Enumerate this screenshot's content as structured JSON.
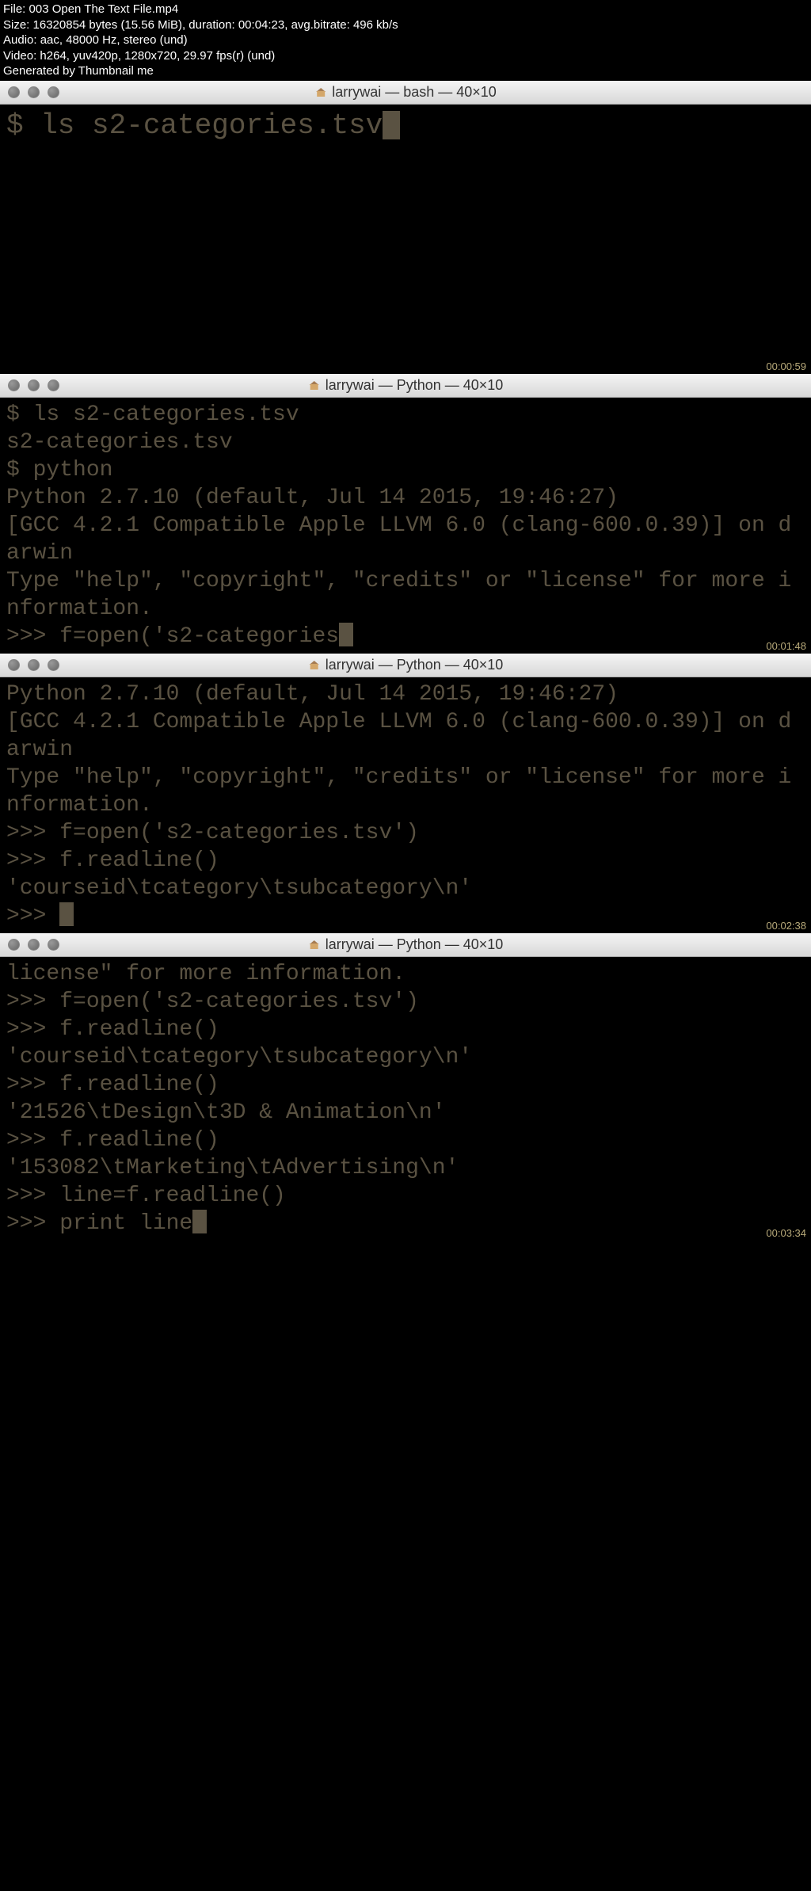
{
  "header": {
    "file": "File: 003 Open The Text File.mp4",
    "size": "Size: 16320854 bytes (15.56 MiB), duration: 00:04:23, avg.bitrate: 496 kb/s",
    "audio": "Audio: aac, 48000 Hz, stereo (und)",
    "video": "Video: h264, yuv420p, 1280x720, 29.97 fps(r) (und)",
    "generated": "Generated by Thumbnail me"
  },
  "windows": [
    {
      "title": "larrywai — bash — 40×10",
      "timestamp": "00:00:59",
      "content": "$ ls s2-categories.tsv",
      "cursor": true,
      "large": true
    },
    {
      "title": "larrywai — Python — 40×10",
      "timestamp": "00:01:48",
      "content": "$ ls s2-categories.tsv\ns2-categories.tsv\n$ python\nPython 2.7.10 (default, Jul 14 2015, 19:46:27)\n[GCC 4.2.1 Compatible Apple LLVM 6.0 (clang-600.0.39)] on darwin\nType \"help\", \"copyright\", \"credits\" or \"license\" for more information.\n>>> f=open('s2-categories",
      "cursor": true,
      "large": false
    },
    {
      "title": "larrywai — Python — 40×10",
      "timestamp": "00:02:38",
      "content_pre": "Python 2.7.10 (default, Jul 14 2015, 19:46:27)\n[GCC 4.2.1 Compatible Apple LLVM 6.0 (clang-600.0.39)] on darwin\nType \"help\", \"copyright\", \"credits\" or \"license\" for more information.\n>>> f=open('s2-categories.tsv')\n>>> f.readline()\n'courseid\\tcategory\\tsubcategory\\n'\n>>> ",
      "cursor": true,
      "large": false
    },
    {
      "title": "larrywai — Python — 40×10",
      "timestamp": "00:03:34",
      "content": "license\" for more information.\n>>> f=open('s2-categories.tsv')\n>>> f.readline()\n'courseid\\tcategory\\tsubcategory\\n'\n>>> f.readline()\n'21526\\tDesign\\t3D & Animation\\n'\n>>> f.readline()\n'153082\\tMarketing\\tAdvertising\\n'\n>>> line=f.readline()\n>>> print line",
      "cursor": true,
      "large": false
    }
  ]
}
